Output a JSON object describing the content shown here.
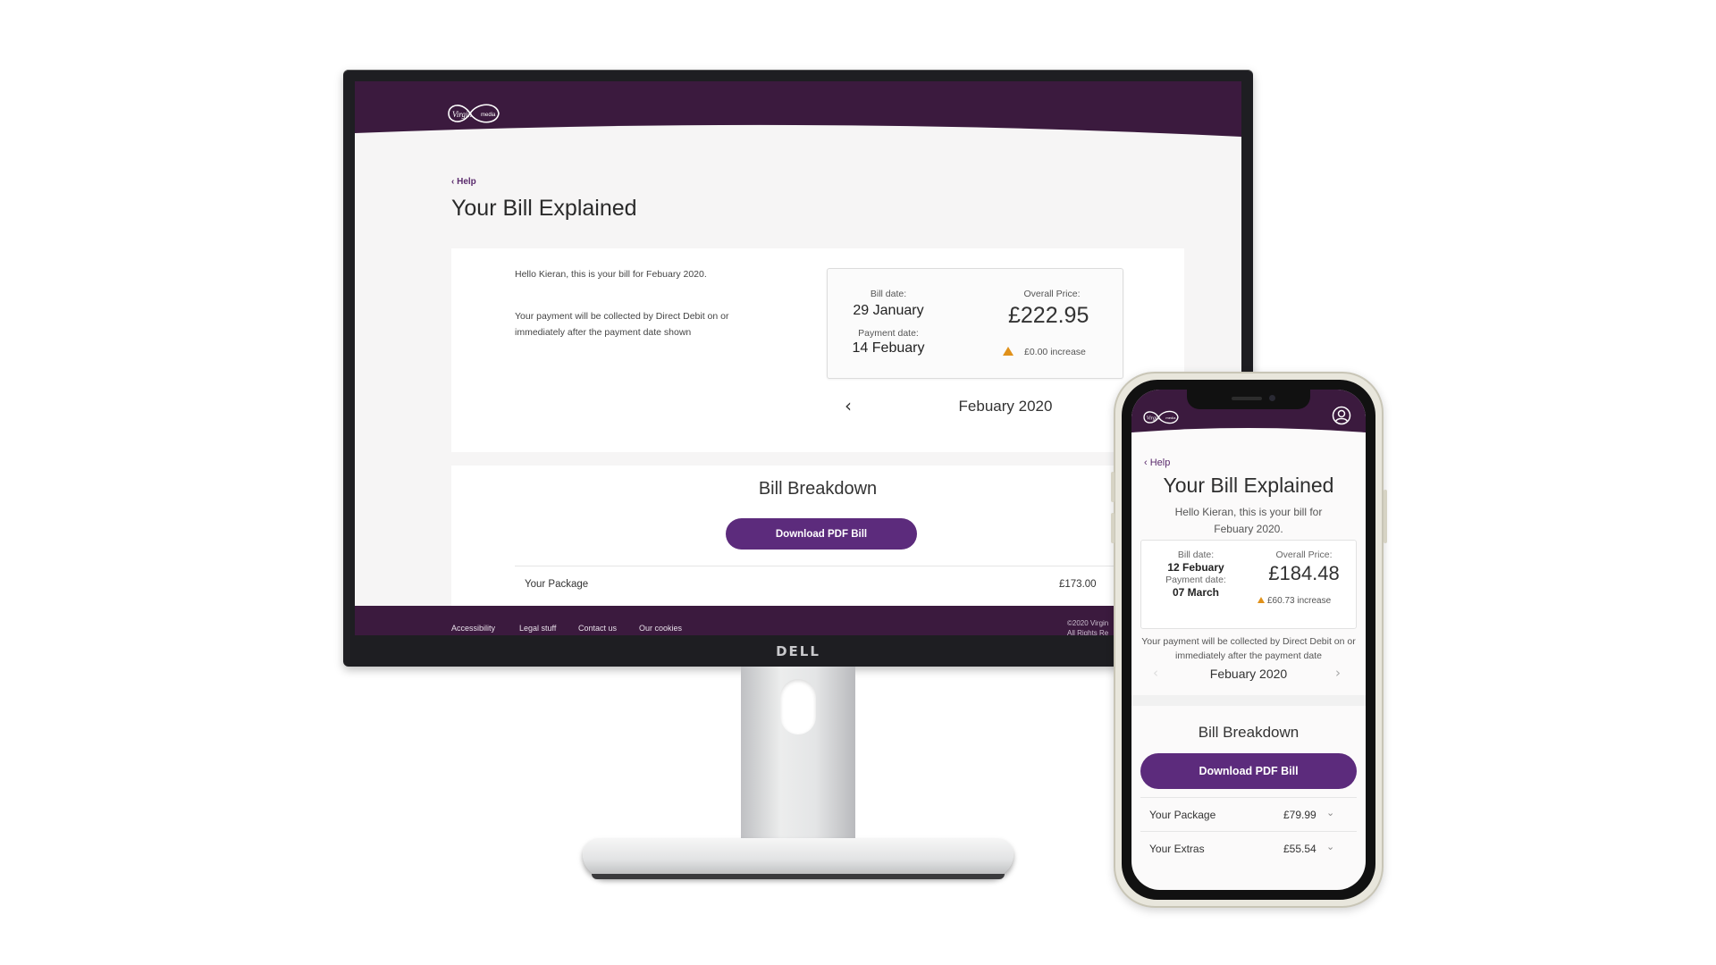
{
  "desktop": {
    "brand": "Virgin media",
    "help_link": "Help",
    "page_title": "Your Bill Explained",
    "greeting": "Hello Kieran, this is your bill for Febuary 2020.",
    "payment_note": "Your payment will be collected by Direct Debit on or immediately after the payment date shown",
    "summary": {
      "bill_date_label": "Bill date:",
      "bill_date": "29 January",
      "payment_date_label": "Payment date:",
      "payment_date": "14 Febuary",
      "overall_price_label": "Overall Price:",
      "overall_price": "£222.95",
      "increase": "£0.00 increase"
    },
    "month_nav": {
      "prev": "‹",
      "current": "Febuary 2020",
      "next": "›"
    },
    "breakdown": {
      "title": "Bill Breakdown",
      "download_label": "Download PDF Bill",
      "rows": [
        {
          "name": "Your Package",
          "amount": "£173.00"
        }
      ]
    },
    "footer": {
      "links": [
        "Accessibility",
        "Legal stuff",
        "Contact us",
        "Our cookies"
      ],
      "copyright_line1": "©2020 Virgin",
      "copyright_line2": "All Rights Re"
    },
    "monitor_brand": "DELL"
  },
  "mobile": {
    "help_link": "Help",
    "page_title": "Your Bill Explained",
    "greeting": "Hello Kieran, this is your bill for Febuary 2020.",
    "summary": {
      "bill_date_label": "Bill date:",
      "bill_date": "12 Febuary",
      "payment_date_label": "Payment date:",
      "payment_date": "07 March",
      "overall_price_label": "Overall Price:",
      "overall_price": "£184.48",
      "increase": "£60.73 increase"
    },
    "payment_note": "Your payment will be collected by Direct Debit on or immediately after the payment date",
    "month_nav": {
      "prev": "‹",
      "current": "Febuary 2020",
      "next": "›"
    },
    "breakdown": {
      "title": "Bill Breakdown",
      "download_label": "Download PDF Bill",
      "rows": [
        {
          "name": "Your Package",
          "amount": "£79.99"
        },
        {
          "name": "Your Extras",
          "amount": "£55.54"
        }
      ]
    }
  },
  "colors": {
    "brand_purple": "#3b1a3e",
    "button_purple": "#5c2b7c",
    "warning_orange": "#e0911a"
  },
  "icons": [
    "virgin-media-logo",
    "chevron-left-icon",
    "chevron-right-icon",
    "chevron-down-icon",
    "warning-triangle-icon",
    "account-icon"
  ]
}
